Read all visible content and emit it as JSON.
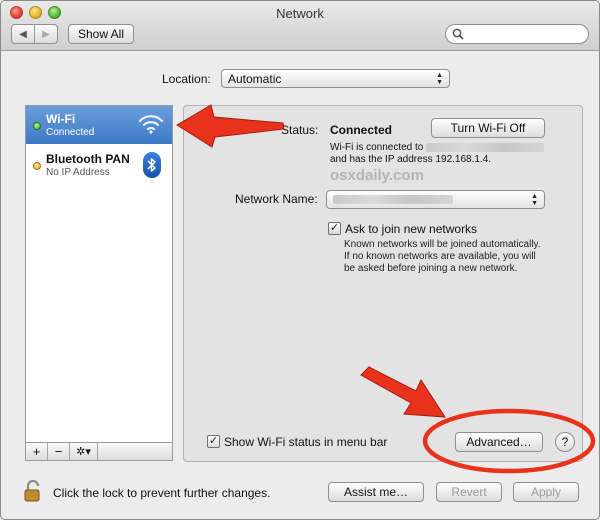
{
  "window": {
    "title": "Network"
  },
  "toolbar": {
    "back": "◀",
    "forward": "▶",
    "show_all": "Show All",
    "search_placeholder": ""
  },
  "location": {
    "label": "Location:",
    "value": "Automatic"
  },
  "sidebar": {
    "items": [
      {
        "name": "Wi-Fi",
        "status": "Connected",
        "dot": "green",
        "icon": "wifi-icon",
        "selected": true
      },
      {
        "name": "Bluetooth PAN",
        "status": "No IP Address",
        "dot": "yellow",
        "icon": "bluetooth-icon",
        "selected": false
      }
    ],
    "add": "+",
    "remove": "−",
    "action": "✲▾"
  },
  "detail": {
    "status_label": "Status:",
    "status_value": "Connected",
    "turn_off_button": "Turn Wi-Fi Off",
    "status_line1": "Wi-Fi is connected to",
    "status_line2": "and has the IP address 192.168.1.4.",
    "watermark": "osxdaily.com",
    "network_name_label": "Network Name:",
    "ask_join_label": "Ask to join new networks",
    "ask_join_checked": true,
    "ask_join_note": "Known networks will be joined automatically. If no known networks are available, you will be asked before joining a new network.",
    "show_status_label": "Show Wi-Fi status in menu bar",
    "show_status_checked": true,
    "advanced_button": "Advanced…",
    "help_button": "?"
  },
  "footer": {
    "lock_text": "Click the lock to prevent further changes.",
    "assist_button": "Assist me…",
    "revert_button": "Revert",
    "apply_button": "Apply"
  },
  "colors": {
    "selection": "#4a86d0",
    "annotation": "#e8321c"
  }
}
